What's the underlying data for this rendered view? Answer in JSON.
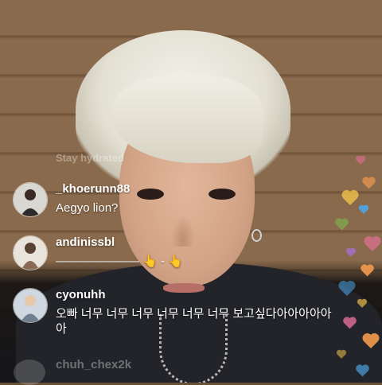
{
  "faded_top": "Stay hydrated",
  "faded_bottom": "chuh_chex2k",
  "comments": [
    {
      "username": "_khoerunn88",
      "text": "Aegyo lion?"
    },
    {
      "username": "andinissbl",
      "text": "——————— 👆 - 👆"
    },
    {
      "username": "cyonuhh",
      "text": "오빠 너무 너무 너무 너무 너무 너무 보고싶다아아아아아아"
    }
  ],
  "heart_colors": [
    "#e7709b",
    "#f29a4c",
    "#f2c34a",
    "#4ea5e8",
    "#7cc24f",
    "#e7709b",
    "#a86fd6",
    "#f29a4c",
    "#4ea5e8",
    "#f2c34a"
  ],
  "colors": {
    "text": "#ffffff"
  }
}
